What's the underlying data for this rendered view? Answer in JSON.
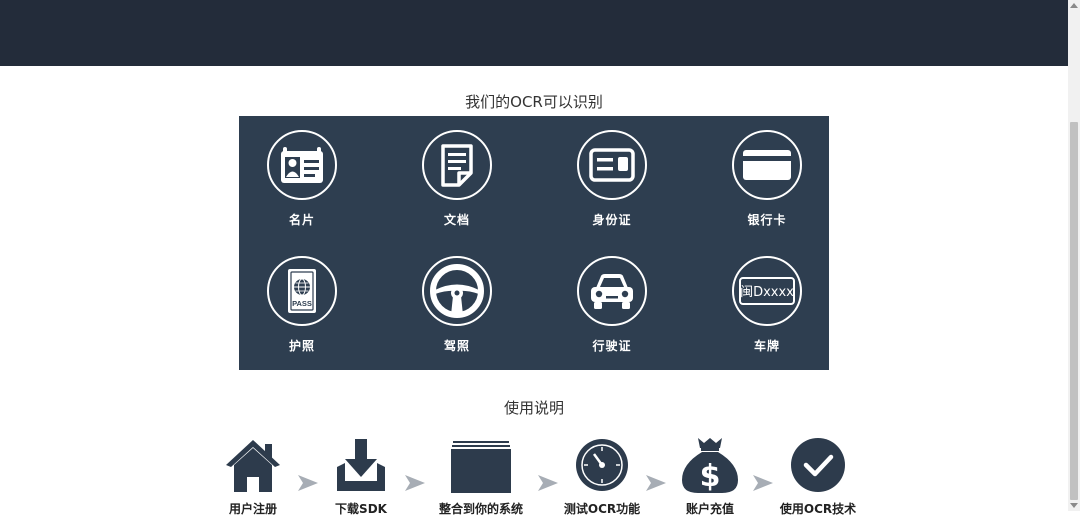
{
  "ocr_section": {
    "title": "我们的OCR可以识别",
    "items": [
      {
        "label": "名片",
        "icon": "business-card-icon"
      },
      {
        "label": "文档",
        "icon": "document-icon"
      },
      {
        "label": "身份证",
        "icon": "id-card-icon"
      },
      {
        "label": "银行卡",
        "icon": "bank-card-icon"
      },
      {
        "label": "护照",
        "icon": "passport-icon"
      },
      {
        "label": "驾照",
        "icon": "steering-wheel-icon"
      },
      {
        "label": "行驶证",
        "icon": "car-icon"
      },
      {
        "label": "车牌",
        "icon": "license-plate-icon"
      }
    ],
    "passport_text": "PASS",
    "plate_text": "闽Dxxxx"
  },
  "usage_section": {
    "title": "使用说明",
    "steps": [
      {
        "label": "用户注册",
        "icon": "home-icon"
      },
      {
        "label": "下载SDK",
        "icon": "download-icon"
      },
      {
        "label": "整合到你的系统",
        "icon": "integrate-icon"
      },
      {
        "label": "测试OCR功能",
        "icon": "stopwatch-icon"
      },
      {
        "label": "账户充值",
        "icon": "money-bag-icon"
      },
      {
        "label": "使用OCR技术",
        "icon": "checkmark-icon"
      }
    ],
    "money_symbol": "$"
  },
  "colors": {
    "header_bg": "#232c3a",
    "panel_bg": "#2e3e50",
    "icon_dark": "#2d3b4c",
    "arrow_gray": "#a7adb5"
  }
}
